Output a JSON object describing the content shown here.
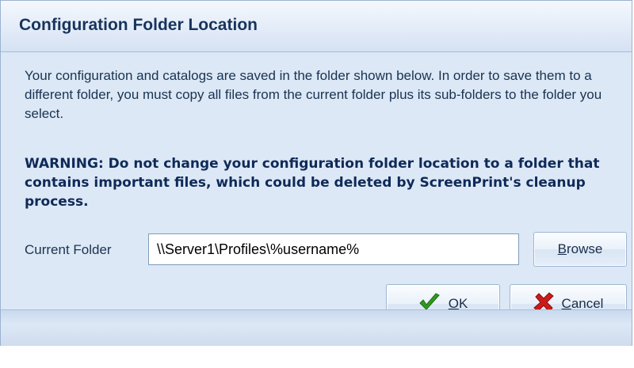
{
  "dialog": {
    "title": "Configuration Folder Location",
    "info_text": "Your configuration and catalogs are saved in the folder shown below. In order to save them to a different folder, you must copy all files from the current folder plus its sub-folders to the folder you select.",
    "warning_text": "WARNING: Do not change your configuration folder location to a folder that contains important files, which could be deleted by ScreenPrint's cleanup process."
  },
  "folder": {
    "label": "Current Folder",
    "value": "\\\\Server1\\Profiles\\%username%"
  },
  "buttons": {
    "browse": {
      "mnemonic": "B",
      "rest": "rowse"
    },
    "ok": {
      "mnemonic": "O",
      "rest": "K"
    },
    "cancel": {
      "mnemonic": "C",
      "rest": "ancel"
    }
  },
  "colors": {
    "ok_check": "#2e9a1f",
    "cancel_x": "#cc1a1a",
    "title_text": "#18345c"
  },
  "icons": {
    "ok": "checkmark-icon",
    "cancel": "red-x-icon"
  }
}
